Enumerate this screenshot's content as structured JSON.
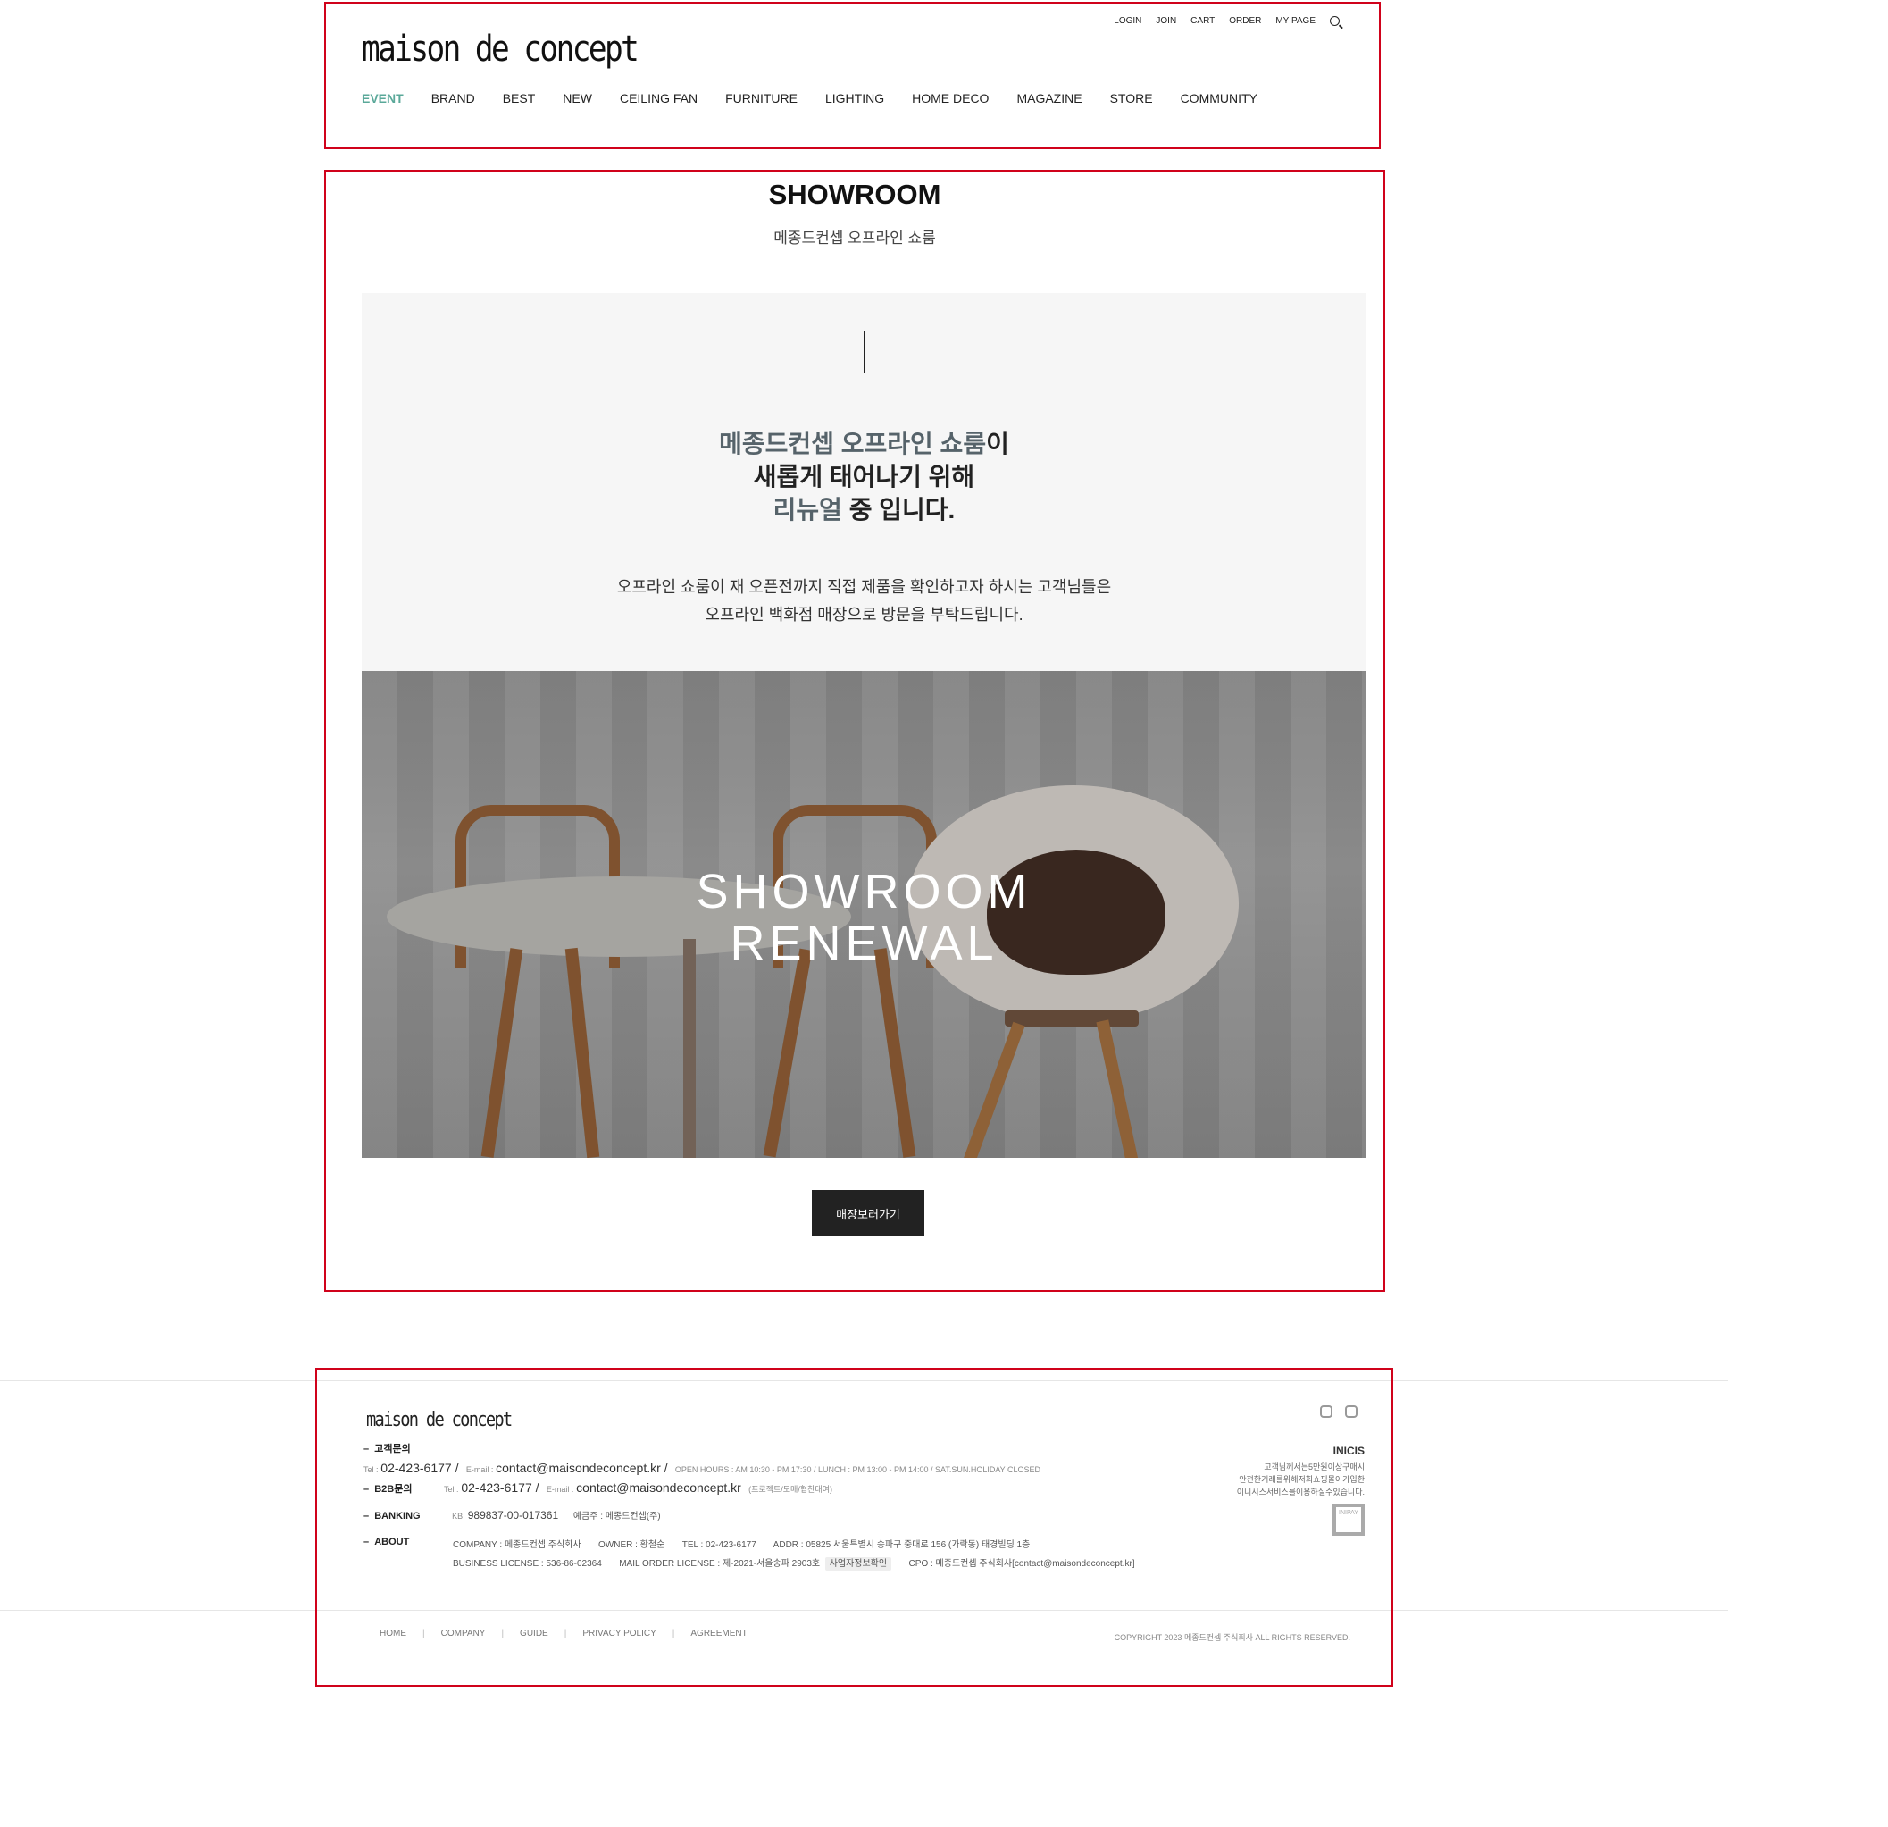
{
  "header": {
    "logo": "maison de concept",
    "top_links": [
      "LOGIN",
      "JOIN",
      "CART",
      "ORDER",
      "MY PAGE"
    ],
    "nav": [
      "EVENT",
      "BRAND",
      "BEST",
      "NEW",
      "CEILING FAN",
      "FURNITURE",
      "LIGHTING",
      "HOME DECO",
      "MAGAZINE",
      "STORE",
      "COMMUNITY"
    ],
    "active_color": "#5aa899"
  },
  "main": {
    "title": "SHOWROOM",
    "subtitle": "메종드컨셉 오프라인 쇼룸",
    "headline_hl1": "메종드컨셉 오프라인 쇼룸",
    "headline_1b": "이",
    "headline_2": "새롭게 태어나기 위해",
    "headline_hl3": "리뉴얼",
    "headline_3b": " 중 입니다.",
    "desc_1": "오프라인 쇼룸이 재 오픈전까지 직접 제품을 확인하고자 하시는 고객님들은",
    "desc_2": "오프라인 백화점 매장으로 방문을 부탁드립니다.",
    "photo_text_1": "SHOWROOM",
    "photo_text_2": "RENEWAL",
    "button": "매장보러가기"
  },
  "footer": {
    "logo": "maison de concept",
    "cs_label": "고객문의",
    "tel_label": "Tel :",
    "tel": "02-423-6177 /",
    "email_label": "E-mail :",
    "email": "contact@maisondeconcept.kr /",
    "hours": "OPEN HOURS : AM 10:30 - PM 17:30 / LUNCH : PM 13:00 - PM 14:00 / SAT.SUN.HOLIDAY CLOSED",
    "b2b_label": "B2B문의",
    "b2b_tel_label": "Tel :",
    "b2b_tel": "02-423-6177 /",
    "b2b_email_label": "E-mail :",
    "b2b_email": "contact@maisondeconcept.kr",
    "b2b_note": "(프로젝트/도매/협찬대여)",
    "banking_label": "BANKING",
    "bank": "KB",
    "account": "989837-00-017361",
    "holder": "예금주 : 메종드컨셉(주)",
    "about_label": "ABOUT",
    "company": "COMPANY : 메종드컨셉 주식회사",
    "owner": "OWNER : 황철순",
    "about_tel": "TEL : 02-423-6177",
    "addr": "ADDR : 05825 서울특별시 송파구 중대로 156 (가락동) 태경빌딩 1층",
    "license": "BUSINESS LICENSE : 536-86-02364",
    "mail_order": "MAIL ORDER LICENSE : 제-2021-서울송파 2903호",
    "biz_check": "사업자정보확인",
    "cpo": "CPO : 메종드컨셉 주식회사[contact@maisondeconcept.kr]",
    "inicis_title": "INICIS",
    "inicis_1": "고객님께서는5만원이상구매시",
    "inicis_2": "안전한거래를위해저희쇼핑몰이가입한",
    "inicis_3": "이니시스서비스를이용하실수있습니다.",
    "inipay": "INIPAY",
    "links": [
      "HOME",
      "COMPANY",
      "GUIDE",
      "PRIVACY POLICY",
      "AGREEMENT"
    ],
    "copyright": "COPYRIGHT 2023 메종드컨셉 주식회사 ALL RIGHTS RESERVED."
  }
}
